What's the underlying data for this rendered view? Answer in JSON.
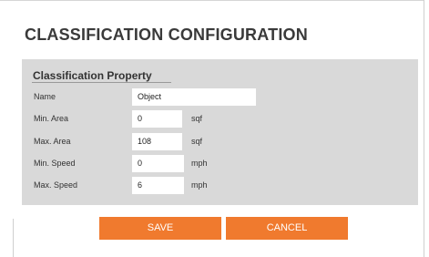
{
  "page": {
    "title": "CLASSIFICATION CONFIGURATION"
  },
  "panel": {
    "title": "Classification Property",
    "rows": [
      {
        "label": "Name",
        "value": "Object",
        "unit": ""
      },
      {
        "label": "Min. Area",
        "value": "0",
        "unit": "sqf"
      },
      {
        "label": "Max. Area",
        "value": "108",
        "unit": "sqf"
      },
      {
        "label": "Min. Speed",
        "value": "0",
        "unit": "mph"
      },
      {
        "label": "Max. Speed",
        "value": "6",
        "unit": "mph"
      }
    ]
  },
  "buttons": {
    "save": "SAVE",
    "cancel": "CANCEL"
  },
  "colors": {
    "accent": "#f07a2e",
    "panel": "#d9d9d9"
  }
}
